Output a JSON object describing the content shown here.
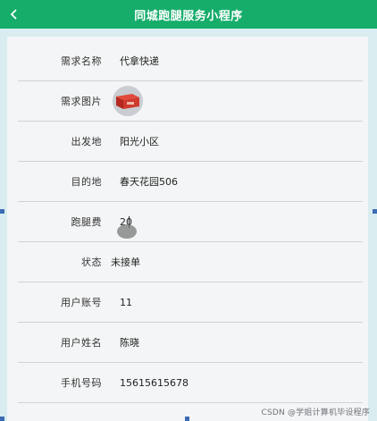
{
  "app": {
    "title": "同城跑腿服务小程序",
    "back_icon": "chevron-left-icon"
  },
  "colors": {
    "header_bg": "#16ad6b",
    "page_bg": "#d9ecef",
    "card_bg": "#f4f5f6"
  },
  "fields": [
    {
      "label": "需求名称",
      "value": "代拿快递"
    },
    {
      "label": "需求图片",
      "value": ""
    },
    {
      "label": "出发地",
      "value": "阳光小区"
    },
    {
      "label": "目的地",
      "value": "春天花园506"
    },
    {
      "label": "跑腿费",
      "value": "20"
    },
    {
      "label": "状态",
      "value": "未接单"
    },
    {
      "label": "用户账号",
      "value": "11"
    },
    {
      "label": "用户姓名",
      "value": "陈晓"
    },
    {
      "label": "手机号码",
      "value": "15615615678"
    }
  ],
  "watermark": "CSDN @学姐计算机毕设程序"
}
